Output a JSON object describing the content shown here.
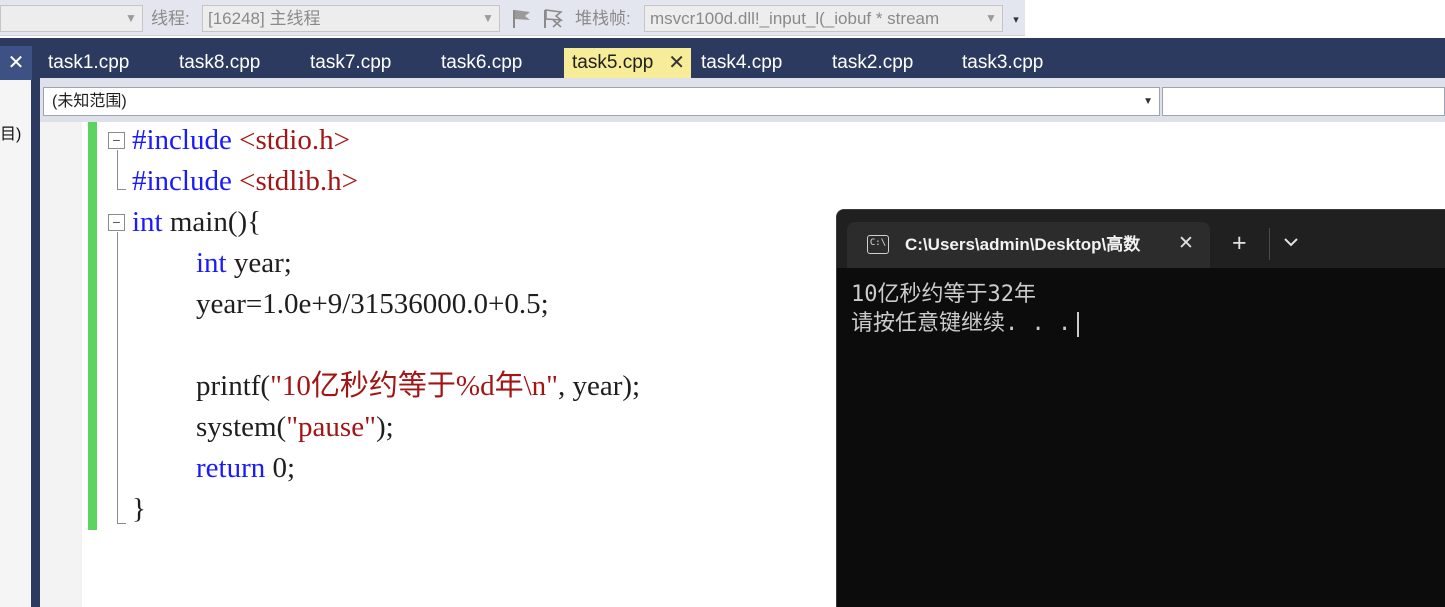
{
  "toolbar": {
    "thread_label": "线程:",
    "thread_value": "[16248] 主线程",
    "stack_label": "堆栈帧:",
    "stack_value": "msvcr100d.dll!_input_l(_iobuf * stream"
  },
  "left_panel": {
    "fragment": "目)"
  },
  "tabs": [
    {
      "label": "task1.cpp"
    },
    {
      "label": "task8.cpp"
    },
    {
      "label": "task7.cpp"
    },
    {
      "label": "task6.cpp"
    },
    {
      "label": "task5.cpp",
      "active": true
    },
    {
      "label": "task4.cpp"
    },
    {
      "label": "task2.cpp"
    },
    {
      "label": "task3.cpp"
    }
  ],
  "scope": {
    "value": "(未知范围)"
  },
  "code": {
    "l1_kw": "#include",
    "l1_hdr": "<stdio.h>",
    "l2_kw": "#include",
    "l2_hdr": "<stdlib.h>",
    "l3_kw": "int",
    "l3_rest": " main(){",
    "l4_kw": "int",
    "l4_rest": " year;",
    "l5": "year=1.0e+9/31536000.0+0.5;",
    "l7_pre": "printf(",
    "l7_str": "\"10亿秒约等于%d年\\n\"",
    "l7_post": ", year);",
    "l8_pre": "system(",
    "l8_str": "\"pause\"",
    "l8_post": ");",
    "l9_kw": "return",
    "l9_rest": " 0;",
    "l10": "}"
  },
  "console": {
    "title": "C:\\Users\\admin\\Desktop\\高数",
    "icon": "cmd-icon",
    "output_line1": "10亿秒约等于32年",
    "output_line2": "请按任意键继续. . ."
  },
  "colors": {
    "accent_tab": "#f7ec98",
    "ide_frame": "#2b3a5e",
    "change_marker": "#5fd35f",
    "keyword": "#1a1aff",
    "string": "#a31515",
    "console_bg": "#0c0c0c"
  }
}
